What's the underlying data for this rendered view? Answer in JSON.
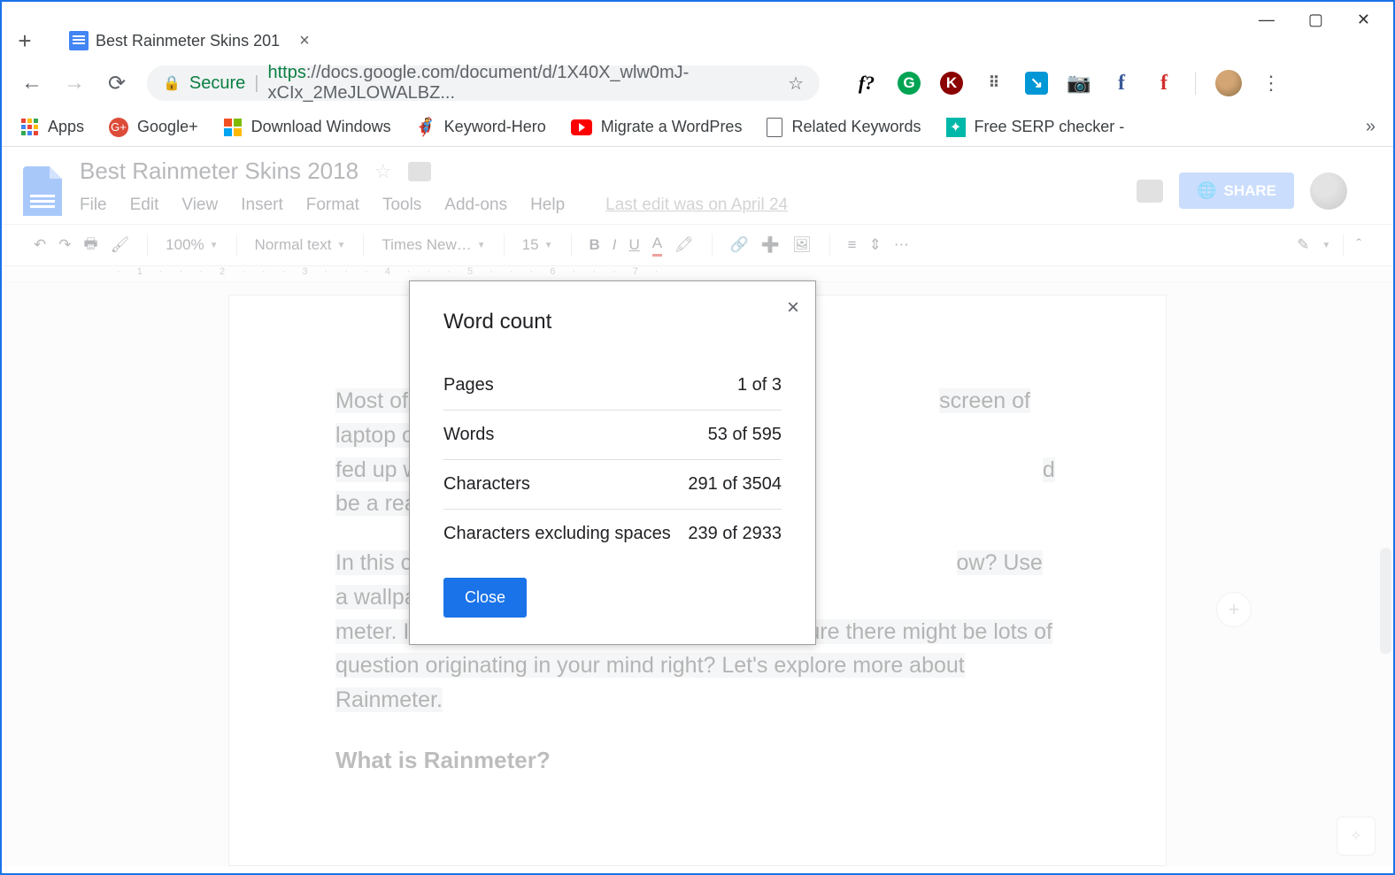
{
  "browser": {
    "tab_title": "Best Rainmeter Skins 201",
    "secure_label": "Secure",
    "url_https": "https",
    "url_rest": "://docs.google.com/document/d/1X40X_wlw0mJ-xCIx_2MeJLOWALBZ..."
  },
  "bookmarks": {
    "apps": "Apps",
    "googleplus": "Google+",
    "download_windows": "Download Windows",
    "keyword_hero": "Keyword-Hero",
    "migrate_wp": "Migrate a WordPres",
    "related_kw": "Related Keywords",
    "serp": "Free SERP checker -"
  },
  "docs": {
    "title": "Best Rainmeter Skins 2018",
    "menus": [
      "File",
      "Edit",
      "View",
      "Insert",
      "Format",
      "Tools",
      "Add-ons",
      "Help"
    ],
    "last_edit": "Last edit was on April 24",
    "share": "SHARE",
    "toolbar": {
      "zoom": "100%",
      "style": "Normal text",
      "font": "Times New…",
      "size": "15"
    },
    "body": {
      "p1a": "Most of the people",
      "p1b": "screen of laptop or desktop ri",
      "p1c": "fed up with the same old Wind",
      "p1d": "d be a reason why you're not able",
      "p2a": "In this condition, it",
      "p2b": "ow? Use a wallpaper or theme",
      "p2c": "meter. If you're not aware of this term, then I'm sure there might be lots of question originating in your mind right? Let's explore more about Rainmeter.",
      "h2": "What is Rainmeter?"
    }
  },
  "modal": {
    "title": "Word count",
    "rows": [
      {
        "label": "Pages",
        "value": "1 of 3"
      },
      {
        "label": "Words",
        "value": "53 of 595"
      },
      {
        "label": "Characters",
        "value": "291 of 3504"
      },
      {
        "label": "Characters excluding spaces",
        "value": "239 of 2933"
      }
    ],
    "close": "Close"
  }
}
